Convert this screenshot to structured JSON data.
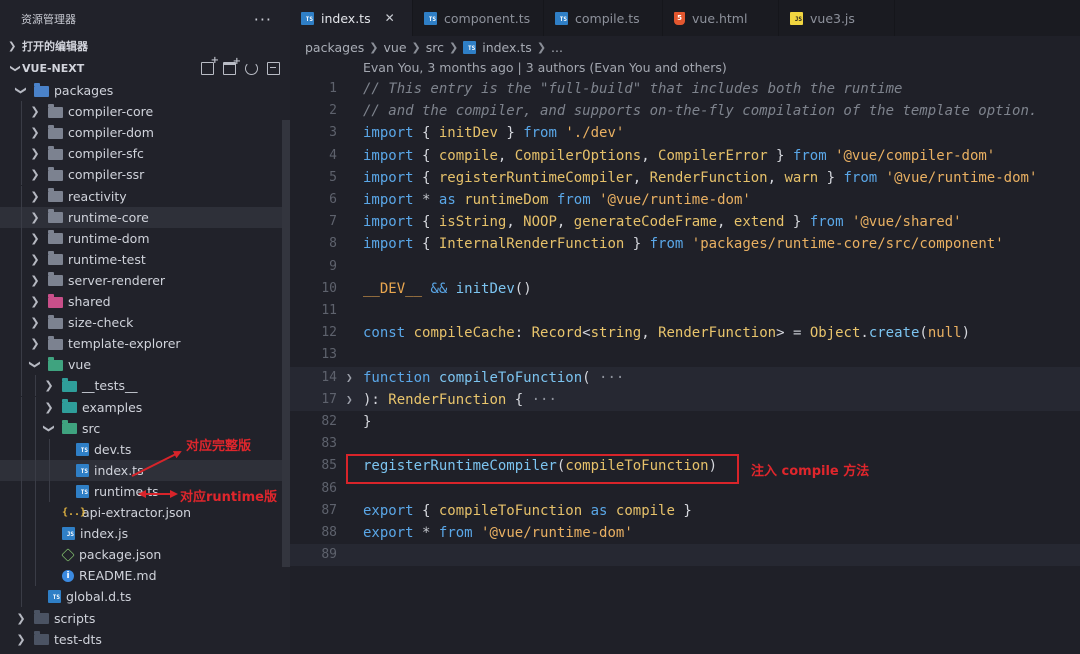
{
  "sidebar": {
    "title": "资源管理器",
    "more": "···",
    "open_editors": "打开的编辑器",
    "workspace": "VUE-NEXT",
    "tree": [
      {
        "label": "packages",
        "depth": 1,
        "expanded": true,
        "icon": "folder-blue"
      },
      {
        "label": "compiler-core",
        "depth": 2,
        "icon": "folder-grey"
      },
      {
        "label": "compiler-dom",
        "depth": 2,
        "icon": "folder-grey"
      },
      {
        "label": "compiler-sfc",
        "depth": 2,
        "icon": "folder-grey"
      },
      {
        "label": "compiler-ssr",
        "depth": 2,
        "icon": "folder-grey"
      },
      {
        "label": "reactivity",
        "depth": 2,
        "icon": "folder-grey"
      },
      {
        "label": "runtime-core",
        "depth": 2,
        "icon": "folder-grey",
        "selected": true
      },
      {
        "label": "runtime-dom",
        "depth": 2,
        "icon": "folder-grey"
      },
      {
        "label": "runtime-test",
        "depth": 2,
        "icon": "folder-grey"
      },
      {
        "label": "server-renderer",
        "depth": 2,
        "icon": "folder-grey"
      },
      {
        "label": "shared",
        "depth": 2,
        "icon": "folder-pink"
      },
      {
        "label": "size-check",
        "depth": 2,
        "icon": "folder-grey"
      },
      {
        "label": "template-explorer",
        "depth": 2,
        "icon": "folder-grey"
      },
      {
        "label": "vue",
        "depth": 2,
        "expanded": true,
        "icon": "folder-green"
      },
      {
        "label": "__tests__",
        "depth": 3,
        "icon": "folder-teal"
      },
      {
        "label": "examples",
        "depth": 3,
        "icon": "folder-teal"
      },
      {
        "label": "src",
        "depth": 3,
        "expanded": true,
        "icon": "folder-green"
      },
      {
        "label": "dev.ts",
        "depth": 4,
        "icon": "ts-file"
      },
      {
        "label": "index.ts",
        "depth": 4,
        "icon": "ts-file",
        "selected": true
      },
      {
        "label": "runtime.ts",
        "depth": 4,
        "icon": "ts-file"
      },
      {
        "label": "api-extractor.json",
        "depth": 3,
        "icon": "json-file"
      },
      {
        "label": "index.js",
        "depth": 3,
        "icon": "js-file"
      },
      {
        "label": "package.json",
        "depth": 3,
        "icon": "package-file"
      },
      {
        "label": "README.md",
        "depth": 3,
        "icon": "info-file"
      },
      {
        "label": "global.d.ts",
        "depth": 2,
        "icon": "ts-file"
      },
      {
        "label": "scripts",
        "depth": 1,
        "icon": "folder-dark"
      },
      {
        "label": "test-dts",
        "depth": 1,
        "icon": "folder-dark"
      }
    ]
  },
  "tabs": [
    {
      "label": "index.ts",
      "active": true,
      "icon": "ts-file"
    },
    {
      "label": "component.ts",
      "icon": "ts-file"
    },
    {
      "label": "compile.ts",
      "icon": "ts-file"
    },
    {
      "label": "vue.html",
      "icon": "html-file"
    },
    {
      "label": "vue3.js",
      "icon": "js-file"
    }
  ],
  "breadcrumb": [
    "packages",
    "vue",
    "src",
    "index.ts",
    "..."
  ],
  "blame": "Evan You, 3 months ago | 3 authors (Evan You and others)",
  "code_lines": [
    {
      "n": "1",
      "tokens": [
        [
          "cm",
          "// This entry is the \"full-build\" that includes both the runtime"
        ]
      ]
    },
    {
      "n": "2",
      "tokens": [
        [
          "cm",
          "// and the compiler, and supports on-the-fly compilation of the template option."
        ]
      ]
    },
    {
      "n": "3",
      "tokens": [
        [
          "kw",
          "import"
        ],
        [
          "pun",
          " { "
        ],
        [
          "id",
          "initDev"
        ],
        [
          "pun",
          " } "
        ],
        [
          "kw",
          "from"
        ],
        [
          "pun",
          " "
        ],
        [
          "str",
          "'./dev'"
        ]
      ]
    },
    {
      "n": "4",
      "tokens": [
        [
          "kw",
          "import"
        ],
        [
          "pun",
          " { "
        ],
        [
          "id",
          "compile"
        ],
        [
          "pun",
          ", "
        ],
        [
          "id",
          "CompilerOptions"
        ],
        [
          "pun",
          ", "
        ],
        [
          "id",
          "CompilerError"
        ],
        [
          "pun",
          " } "
        ],
        [
          "kw",
          "from"
        ],
        [
          "pun",
          " "
        ],
        [
          "str",
          "'@vue/compiler-dom'"
        ]
      ]
    },
    {
      "n": "5",
      "tokens": [
        [
          "kw",
          "import"
        ],
        [
          "pun",
          " { "
        ],
        [
          "id",
          "registerRuntimeCompiler"
        ],
        [
          "pun",
          ", "
        ],
        [
          "id",
          "RenderFunction"
        ],
        [
          "pun",
          ", "
        ],
        [
          "id",
          "warn"
        ],
        [
          "pun",
          " } "
        ],
        [
          "kw",
          "from"
        ],
        [
          "pun",
          " "
        ],
        [
          "str",
          "'@vue/runtime-dom'"
        ]
      ]
    },
    {
      "n": "6",
      "tokens": [
        [
          "kw",
          "import"
        ],
        [
          "pun",
          " "
        ],
        [
          "op",
          "*"
        ],
        [
          "pun",
          " "
        ],
        [
          "kw",
          "as"
        ],
        [
          "pun",
          " "
        ],
        [
          "id",
          "runtimeDom"
        ],
        [
          "pun",
          " "
        ],
        [
          "kw",
          "from"
        ],
        [
          "pun",
          " "
        ],
        [
          "str",
          "'@vue/runtime-dom'"
        ]
      ]
    },
    {
      "n": "7",
      "tokens": [
        [
          "kw",
          "import"
        ],
        [
          "pun",
          " { "
        ],
        [
          "id",
          "isString"
        ],
        [
          "pun",
          ", "
        ],
        [
          "id",
          "NOOP"
        ],
        [
          "pun",
          ", "
        ],
        [
          "id",
          "generateCodeFrame"
        ],
        [
          "pun",
          ", "
        ],
        [
          "id",
          "extend"
        ],
        [
          "pun",
          " } "
        ],
        [
          "kw",
          "from"
        ],
        [
          "pun",
          " "
        ],
        [
          "str",
          "'@vue/shared'"
        ]
      ]
    },
    {
      "n": "8",
      "tokens": [
        [
          "kw",
          "import"
        ],
        [
          "pun",
          " { "
        ],
        [
          "id",
          "InternalRenderFunction"
        ],
        [
          "pun",
          " } "
        ],
        [
          "kw",
          "from"
        ],
        [
          "pun",
          " "
        ],
        [
          "str",
          "'packages/runtime-core/src/component'"
        ]
      ]
    },
    {
      "n": "9",
      "tokens": []
    },
    {
      "n": "10",
      "tokens": [
        [
          "dev",
          "__DEV__"
        ],
        [
          "pun",
          " "
        ],
        [
          "kw",
          "&&"
        ],
        [
          "pun",
          " "
        ],
        [
          "fn",
          "initDev"
        ],
        [
          "pun",
          "()"
        ]
      ]
    },
    {
      "n": "11",
      "tokens": []
    },
    {
      "n": "12",
      "tokens": [
        [
          "kw",
          "const"
        ],
        [
          "pun",
          " "
        ],
        [
          "id",
          "compileCache"
        ],
        [
          "pun",
          ": "
        ],
        [
          "type",
          "Record"
        ],
        [
          "pun",
          "<"
        ],
        [
          "type",
          "string"
        ],
        [
          "pun",
          ", "
        ],
        [
          "type",
          "RenderFunction"
        ],
        [
          "pun",
          "> "
        ],
        [
          "op",
          "="
        ],
        [
          "pun",
          " "
        ],
        [
          "type",
          "Object"
        ],
        [
          "pun",
          "."
        ],
        [
          "fn",
          "create"
        ],
        [
          "pun",
          "("
        ],
        [
          "str",
          "null"
        ],
        [
          "pun",
          ")"
        ]
      ]
    },
    {
      "n": "13",
      "tokens": []
    },
    {
      "n": "14",
      "fold": true,
      "bg": true,
      "tokens": [
        [
          "kw",
          "function"
        ],
        [
          "pun",
          " "
        ],
        [
          "fn",
          "compileToFunction"
        ],
        [
          "pun",
          "( "
        ],
        [
          "gray",
          "···"
        ]
      ]
    },
    {
      "n": "17",
      "fold": true,
      "bg": true,
      "tokens": [
        [
          "pun",
          "): "
        ],
        [
          "type",
          "RenderFunction"
        ],
        [
          "pun",
          " { "
        ],
        [
          "gray",
          "···"
        ]
      ]
    },
    {
      "n": "82",
      "tokens": [
        [
          "pun",
          "}"
        ]
      ]
    },
    {
      "n": "83",
      "tokens": []
    },
    {
      "n": "85",
      "tokens": [
        [
          "fn",
          "registerRuntimeCompiler"
        ],
        [
          "pun",
          "("
        ],
        [
          "id",
          "compileToFunction"
        ],
        [
          "pun",
          ")"
        ]
      ]
    },
    {
      "n": "86",
      "tokens": []
    },
    {
      "n": "87",
      "tokens": [
        [
          "kw",
          "export"
        ],
        [
          "pun",
          " { "
        ],
        [
          "id",
          "compileToFunction"
        ],
        [
          "pun",
          " "
        ],
        [
          "kw",
          "as"
        ],
        [
          "pun",
          " "
        ],
        [
          "id",
          "compile"
        ],
        [
          "pun",
          " }"
        ]
      ]
    },
    {
      "n": "88",
      "tokens": [
        [
          "kw",
          "export"
        ],
        [
          "pun",
          " "
        ],
        [
          "op",
          "*"
        ],
        [
          "pun",
          " "
        ],
        [
          "kw",
          "from"
        ],
        [
          "pun",
          " "
        ],
        [
          "str",
          "'@vue/runtime-dom'"
        ]
      ]
    },
    {
      "n": "89",
      "bg": true,
      "tokens": []
    }
  ],
  "annotations": {
    "full_build": "对应完整版",
    "runtime_build": "对应runtime版",
    "inject": "注入 compile 方法"
  },
  "colors": {
    "annotation_red": "#d8242a",
    "keyword": "#5aa7e8",
    "identifier": "#e6c16a",
    "string": "#e9b062",
    "comment": "#7e838d"
  }
}
